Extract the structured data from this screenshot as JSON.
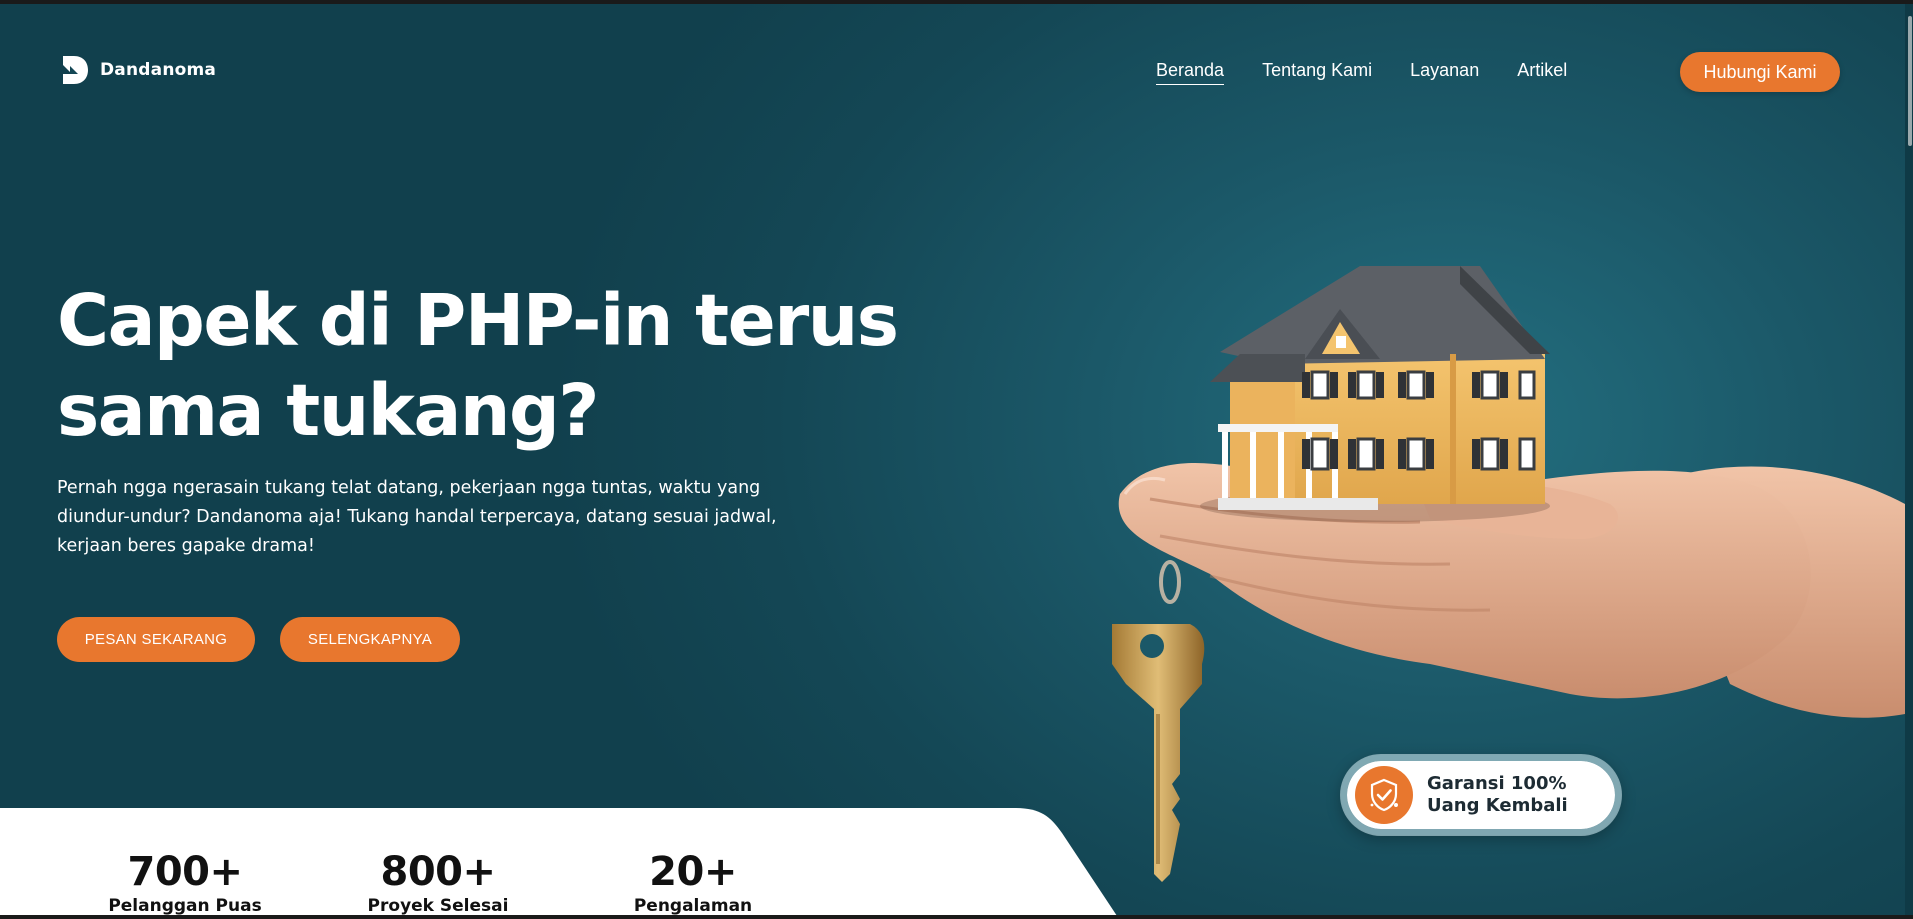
{
  "brand": {
    "name": "Dandanoma",
    "logo_icon": "dandanoma-logo-icon"
  },
  "nav": {
    "links": [
      {
        "label": "Beranda",
        "active": true
      },
      {
        "label": "Tentang Kami",
        "active": false
      },
      {
        "label": "Layanan",
        "active": false
      },
      {
        "label": "Artikel",
        "active": false
      }
    ],
    "contact_label": "Hubungi Kami"
  },
  "hero": {
    "title_line1": "Capek di PHP-in terus",
    "title_line2": "sama tukang?",
    "description": "Pernah ngga ngerasain tukang telat datang, pekerjaan ngga tuntas, waktu yang diundur-undur? Dandanoma aja! Tukang handal terpercaya, datang sesuai jadwal, kerjaan beres gapake drama!",
    "primary_cta": "PESAN SEKARANG",
    "secondary_cta": "SELENGKAPNYA"
  },
  "guarantee": {
    "line1": "Garansi 100%",
    "line2": "Uang Kembali",
    "icon": "shield-check-icon"
  },
  "stats": [
    {
      "value": "700+",
      "label": "Pelanggan Puas"
    },
    {
      "value": "800+",
      "label": "Proyek Selesai"
    },
    {
      "value": "20+",
      "label": "Pengalaman"
    }
  ],
  "colors": {
    "accent": "#e8772e",
    "background": "#144755",
    "text_light": "#ffffff",
    "text_dark": "#111111"
  }
}
